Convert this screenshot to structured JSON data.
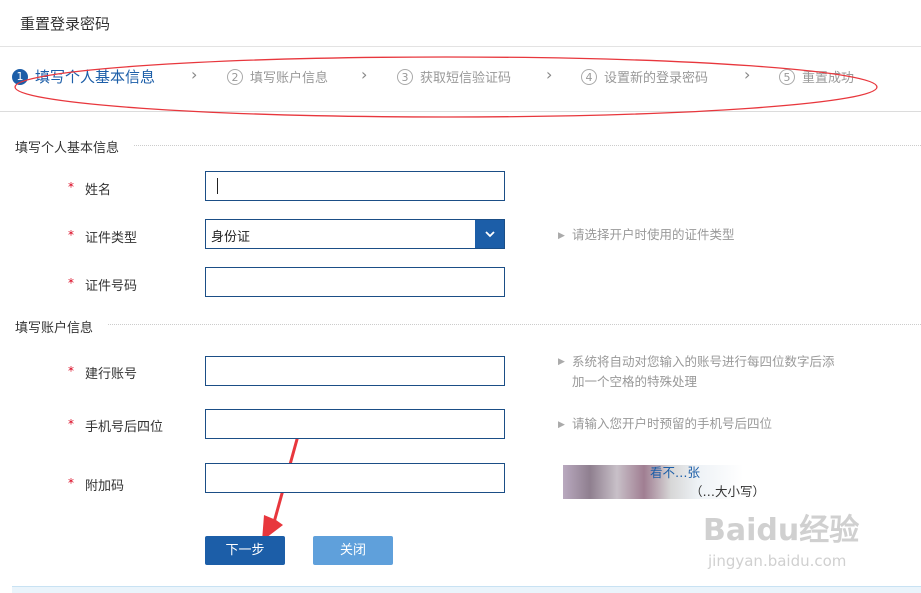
{
  "header": {
    "title": "重置登录密码"
  },
  "steps": [
    {
      "num": "1",
      "label": "填写个人基本信息"
    },
    {
      "num": "2",
      "label": "填写账户信息"
    },
    {
      "num": "3",
      "label": "获取短信验证码"
    },
    {
      "num": "4",
      "label": "设置新的登录密码"
    },
    {
      "num": "5",
      "label": "重置成功"
    }
  ],
  "step_separator": "›",
  "section_personal": {
    "title": "填写个人基本信息",
    "name": {
      "label": "姓名",
      "value": ""
    },
    "id_type": {
      "label": "证件类型",
      "value": "身份证",
      "hint": "请选择开户时使用的证件类型"
    },
    "id_number": {
      "label": "证件号码",
      "value": ""
    }
  },
  "section_account": {
    "title": "填写账户信息",
    "account": {
      "label": "建行账号",
      "value": "",
      "hint_line1": "系统将自动对您输入的账号进行每四位数字后添",
      "hint_line2": "加一个空格的特殊处理"
    },
    "phone": {
      "label": "手机号后四位",
      "value": "",
      "hint": "请输入您开户时预留的手机号后四位"
    },
    "captcha": {
      "label": "附加码",
      "value": "",
      "text_line1": "看不…张",
      "text_line2": "（…大小写）"
    }
  },
  "required_mark": "*",
  "buttons": {
    "next": "下一步",
    "close": "关闭"
  },
  "watermark": {
    "brand": "Baidu经验",
    "url": "jingyan.baidu.com"
  },
  "colors": {
    "accent": "#1c5ea8",
    "annotation": "#e8373d",
    "required": "#d9001b"
  }
}
